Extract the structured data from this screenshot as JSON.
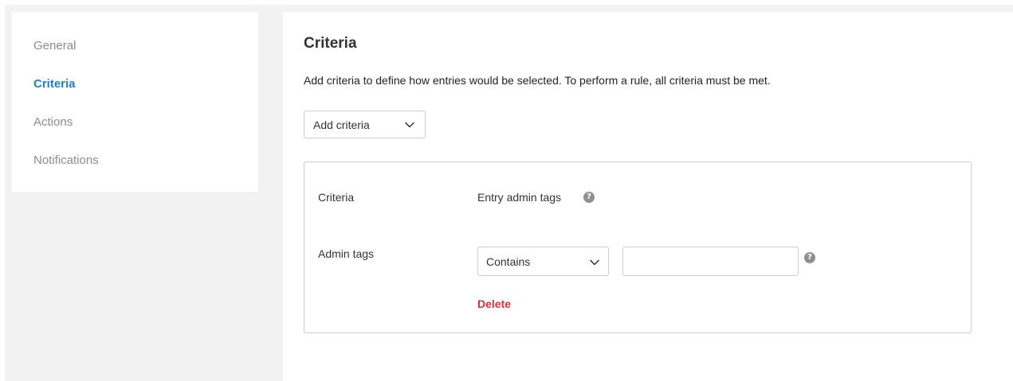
{
  "sidebar": {
    "items": [
      {
        "label": "General",
        "active": false
      },
      {
        "label": "Criteria",
        "active": true
      },
      {
        "label": "Actions",
        "active": false
      },
      {
        "label": "Notifications",
        "active": false
      }
    ]
  },
  "main": {
    "title": "Criteria",
    "description": "Add criteria to define how entries would be selected. To perform a rule, all criteria must be met.",
    "add_button_label": "Add criteria",
    "card": {
      "criteria_label": "Criteria",
      "criteria_value": "Entry admin tags",
      "admin_tags_label": "Admin tags",
      "operator_value": "Contains",
      "tags_input_value": "",
      "delete_label": "Delete"
    }
  },
  "icons": {
    "help": "?",
    "help_icon_name": "help-circle-icon",
    "chevron_icon_name": "chevron-down-icon"
  },
  "colors": {
    "accent": "#1e7fd8",
    "danger": "#e12b38",
    "muted": "#8c8c8c",
    "background": "#f2f2f2"
  }
}
